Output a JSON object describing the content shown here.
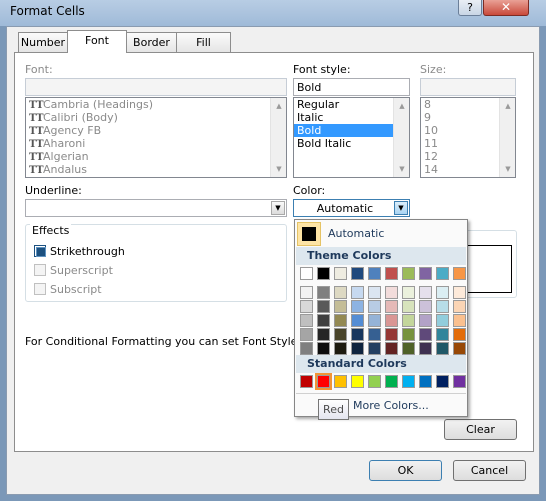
{
  "window": {
    "title": "Format Cells",
    "help": "?",
    "close": "✕"
  },
  "tabs": [
    {
      "label": "Number",
      "active": false
    },
    {
      "label": "Font",
      "active": true
    },
    {
      "label": "Border",
      "active": false
    },
    {
      "label": "Fill",
      "active": false
    }
  ],
  "font": {
    "label": "Font:",
    "value": "",
    "items": [
      "Cambria (Headings)",
      "Calibri (Body)",
      "Agency FB",
      "Aharoni",
      "Algerian",
      "Andalus"
    ]
  },
  "font_style": {
    "label": "Font style:",
    "value": "Bold",
    "items": [
      "Regular",
      "Italic",
      "Bold",
      "Bold Italic"
    ],
    "selected": "Bold"
  },
  "size": {
    "label": "Size:",
    "value": "",
    "items": [
      "8",
      "9",
      "10",
      "11",
      "12",
      "14"
    ]
  },
  "underline": {
    "label": "Underline:",
    "value": ""
  },
  "color": {
    "label": "Color:",
    "value": "Automatic"
  },
  "effects": {
    "legend": "Effects",
    "strikethrough": {
      "label": "Strikethrough",
      "checked": true
    },
    "superscript": {
      "label": "Superscript",
      "checked": false
    },
    "subscript": {
      "label": "Subscript",
      "checked": false
    }
  },
  "info_text": "For Conditional Formatting you can set Font Style, Unde",
  "buttons": {
    "clear": "Clear",
    "ok": "OK",
    "cancel": "Cancel"
  },
  "color_popup": {
    "automatic_label": "Automatic",
    "automatic_color": "#000000",
    "theme_header": "Theme Colors",
    "standard_header": "Standard Colors",
    "more_colors": "More Colors...",
    "theme_top": [
      "#ffffff",
      "#000000",
      "#eeece1",
      "#1f497d",
      "#4f81bd",
      "#c0504d",
      "#9bbb59",
      "#8064a2",
      "#4bacc6",
      "#f79646"
    ],
    "theme_shades": [
      [
        "#f2f2f2",
        "#7f7f7f",
        "#ddd9c3",
        "#c6d9f0",
        "#dbe5f1",
        "#f2dcdb",
        "#ebf1dd",
        "#e5e0ec",
        "#dbeef3",
        "#fdeada"
      ],
      [
        "#d8d8d8",
        "#595959",
        "#c4bd97",
        "#8db3e2",
        "#b8cce4",
        "#e5b9b7",
        "#d7e3bc",
        "#ccc1d9",
        "#b7dde8",
        "#fbd5b5"
      ],
      [
        "#bfbfbf",
        "#3f3f3f",
        "#938953",
        "#548dd4",
        "#95b3d7",
        "#d99694",
        "#c3d69b",
        "#b2a2c7",
        "#92cddc",
        "#fac08f"
      ],
      [
        "#a5a5a5",
        "#262626",
        "#494429",
        "#17365d",
        "#366092",
        "#953734",
        "#76923c",
        "#5f497a",
        "#31859b",
        "#e36c09"
      ],
      [
        "#7f7f7f",
        "#0c0c0c",
        "#1d1b10",
        "#0f243e",
        "#244061",
        "#632423",
        "#4f6128",
        "#3f3151",
        "#205867",
        "#974806"
      ]
    ],
    "standard": [
      "#c00000",
      "#ff0000",
      "#ffc000",
      "#ffff00",
      "#92d050",
      "#00b050",
      "#00b0f0",
      "#0070c0",
      "#002060",
      "#7030a0"
    ],
    "hovered_standard": "Red"
  },
  "tooltip": "Red"
}
